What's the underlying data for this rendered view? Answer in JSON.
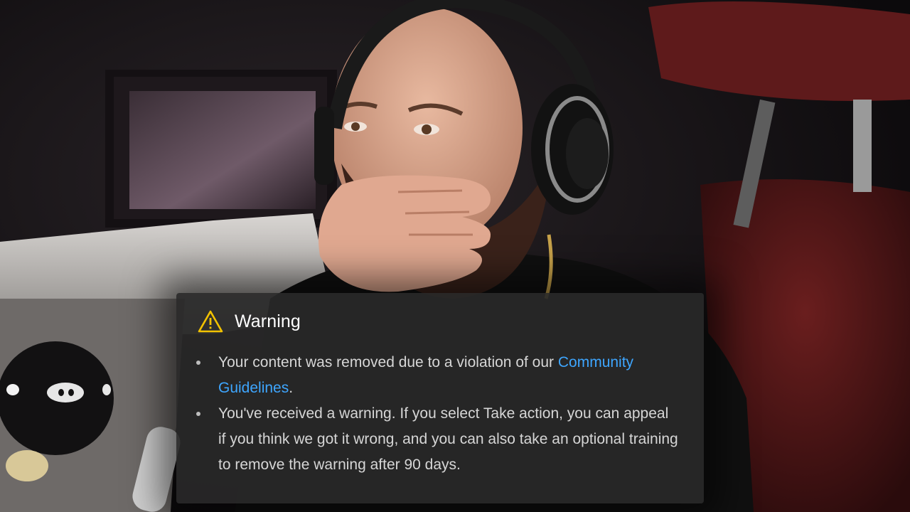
{
  "dialog": {
    "icon": "warning-triangle-icon",
    "title": "Warning",
    "accent_color": "#3ea6ff",
    "warning_color": "#f2c200",
    "bullet1": {
      "before": "Your content was removed due to a violation of our ",
      "link": "Community Guidelines",
      "after": "."
    },
    "bullet2": "You've received a warning. If you select Take action, you can appeal if you think we got it wrong, and you can also take an optional training to remove the warning after 90 days."
  }
}
